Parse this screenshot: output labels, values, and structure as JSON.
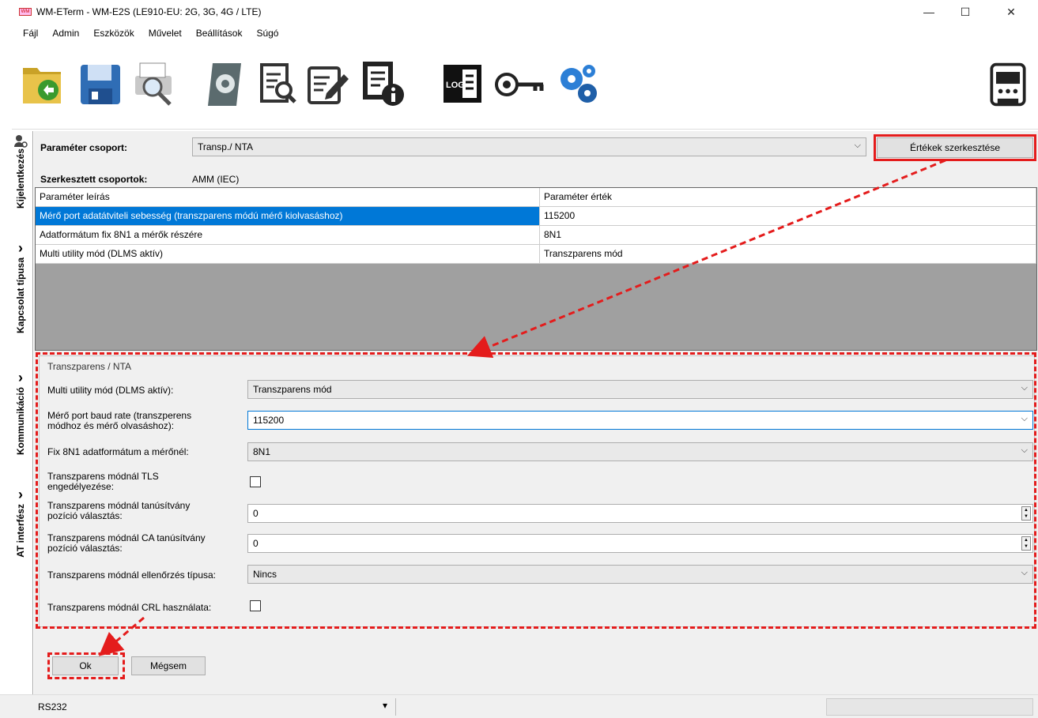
{
  "window": {
    "title": "WM-ETerm - WM-E2S (LE910-EU: 2G, 3G, 4G / LTE)",
    "minimize": "—",
    "maximize": "☐",
    "close": "✕"
  },
  "menu": [
    "Fájl",
    "Admin",
    "Eszközök",
    "Művelet",
    "Beállítások",
    "Súgó"
  ],
  "toolbar_icons": [
    "open-folder-icon",
    "save-disk-icon",
    "print-preview-icon",
    "settings-sheet-icon",
    "view-document-icon",
    "edit-document-icon",
    "document-info-icon",
    "log-icon",
    "key-rotate-icon",
    "gears-icon",
    "meter-icon"
  ],
  "sidebar": {
    "tabs": [
      "Kijelentkezés",
      "Kapcsolat típusa",
      "Kommunikáció",
      "AT interfész"
    ]
  },
  "param_group": {
    "label": "Paraméter csoport:",
    "value": "Transp./ NTA",
    "edit_button": "Értékek szerkesztése",
    "edited_label": "Szerkesztett csoportok:",
    "edited_value": "AMM (IEC)"
  },
  "grid": {
    "headers": [
      "Paraméter leírás",
      "Paraméter érték"
    ],
    "rows": [
      [
        "Mérő port adatátviteli sebesség (transzparens módú mérő kiolvasáshoz)",
        "115200"
      ],
      [
        "Adatformátum fix 8N1 a mérők részére",
        "8N1"
      ],
      [
        "Multi utility mód (DLMS aktív)",
        "Transzparens mód"
      ]
    ]
  },
  "form": {
    "group_title": "Transzparens / NTA",
    "multi_utility_label": "Multi utility mód (DLMS aktív):",
    "multi_utility_value": "Transzparens mód",
    "baud_label_1": "Mérő port baud rate (transzperens",
    "baud_label_2": "módhoz és mérő olvasáshoz):",
    "baud_value": "115200",
    "fix8n1_label": "Fix 8N1 adatformátum a mérőnél:",
    "fix8n1_value": "8N1",
    "tls_label_1": "Transzparens módnál TLS",
    "tls_label_2": "engedélyezése:",
    "cert_label_1": "Transzparens módnál tanúsítvány",
    "cert_label_2": "pozíció választás:",
    "cert_value": "0",
    "ca_label_1": "Transzparens módnál CA tanúsítvány",
    "ca_label_2": "pozíció választás:",
    "ca_value": "0",
    "check_label": "Transzparens módnál ellenőrzés típusa:",
    "check_value": "Nincs",
    "crl_label": "Transzparens módnál CRL használata:"
  },
  "buttons": {
    "ok": "Ok",
    "cancel": "Mégsem"
  },
  "status": {
    "port": "RS232",
    "dropdown": "▾"
  },
  "colors": {
    "annotation_red": "#e41c1c",
    "selection_blue": "#0078d7"
  }
}
